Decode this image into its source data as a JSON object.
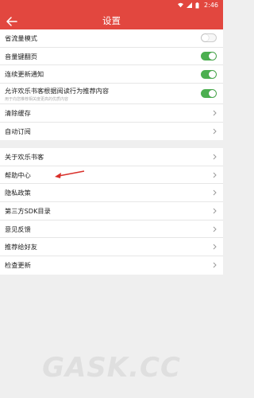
{
  "status_bar": {
    "time": "2:46"
  },
  "header": {
    "title": "设置"
  },
  "group1": [
    {
      "label": "省流量模式",
      "control": "toggle",
      "on": false
    },
    {
      "label": "音量键翻页",
      "control": "toggle",
      "on": true
    },
    {
      "label": "连续更新通知",
      "control": "toggle",
      "on": true
    },
    {
      "label": "允许欢乐书客根据阅读行为推荐内容",
      "sub": "用于向您推荐相关度更高的优质内容",
      "control": "toggle",
      "on": true
    },
    {
      "label": "清除缓存",
      "control": "chevron"
    },
    {
      "label": "自动订阅",
      "control": "chevron"
    }
  ],
  "group2": [
    {
      "label": "关于欢乐书客",
      "control": "chevron"
    },
    {
      "label": "帮助中心",
      "control": "chevron"
    },
    {
      "label": "隐私政策",
      "control": "chevron"
    },
    {
      "label": "第三方SDK目录",
      "control": "chevron"
    },
    {
      "label": "意见反馈",
      "control": "chevron"
    },
    {
      "label": "推荐给好友",
      "control": "chevron"
    },
    {
      "label": "检查更新",
      "control": "chevron"
    }
  ],
  "watermark": {
    "text": "GASK.CC"
  },
  "colors": {
    "accent": "#e2473f",
    "toggle_on": "#4caf50",
    "annotation": "#d9302a"
  }
}
